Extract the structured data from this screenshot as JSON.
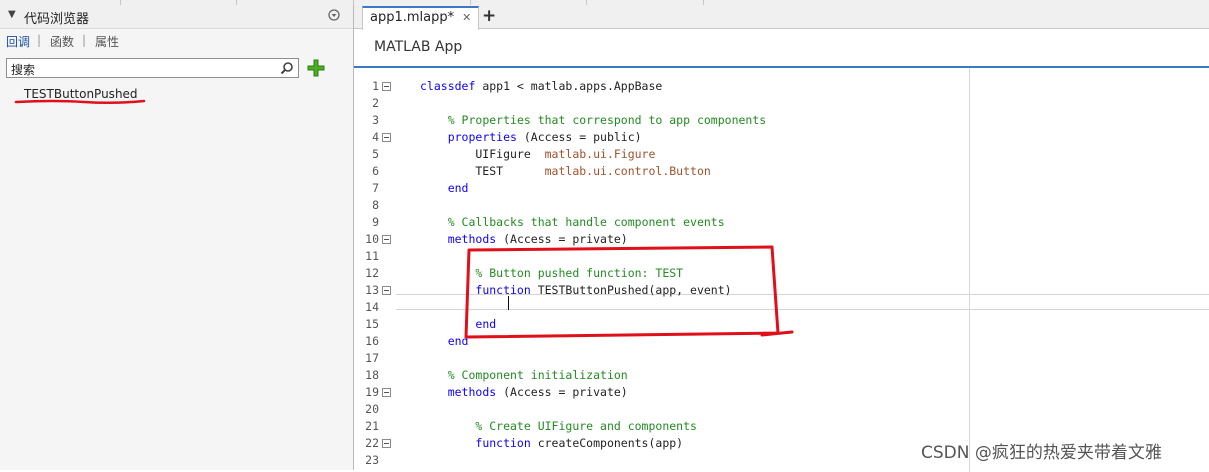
{
  "top_strip": {},
  "left_panel": {
    "title": "代码浏览器",
    "tabs": [
      "回调",
      "函数",
      "属性"
    ],
    "search_placeholder": "搜索",
    "callbacks": [
      "TESTButtonPushed"
    ]
  },
  "editor": {
    "tab_label": "app1.mlapp*",
    "app_title": "MATLAB App",
    "cursor_line": 14,
    "lines": [
      {
        "n": "1",
        "fold": true,
        "t": [
          [
            "kw",
            "classdef"
          ],
          [
            "pl",
            " app1 < matlab.apps.AppBase"
          ]
        ]
      },
      {
        "n": "2",
        "fold": false,
        "t": []
      },
      {
        "n": "3",
        "fold": false,
        "t": [
          [
            "pl",
            "    "
          ],
          [
            "cm",
            "% Properties that correspond to app components"
          ]
        ]
      },
      {
        "n": "4",
        "fold": true,
        "t": [
          [
            "pl",
            "    "
          ],
          [
            "kw",
            "properties"
          ],
          [
            "pl",
            " (Access = public)"
          ]
        ]
      },
      {
        "n": "5",
        "fold": false,
        "t": [
          [
            "pl",
            "        UIFigure  "
          ],
          [
            "ty",
            "matlab.ui.Figure"
          ]
        ]
      },
      {
        "n": "6",
        "fold": false,
        "t": [
          [
            "pl",
            "        TEST      "
          ],
          [
            "ty",
            "matlab.ui.control.Button"
          ]
        ]
      },
      {
        "n": "7",
        "fold": false,
        "t": [
          [
            "pl",
            "    "
          ],
          [
            "kw",
            "end"
          ]
        ]
      },
      {
        "n": "8",
        "fold": false,
        "t": []
      },
      {
        "n": "9",
        "fold": false,
        "t": [
          [
            "pl",
            "    "
          ],
          [
            "cm",
            "% Callbacks that handle component events"
          ]
        ]
      },
      {
        "n": "10",
        "fold": true,
        "t": [
          [
            "pl",
            "    "
          ],
          [
            "kw",
            "methods"
          ],
          [
            "pl",
            " (Access = private)"
          ]
        ]
      },
      {
        "n": "11",
        "fold": false,
        "t": []
      },
      {
        "n": "12",
        "fold": false,
        "t": [
          [
            "pl",
            "        "
          ],
          [
            "cm",
            "% Button pushed function: TEST"
          ]
        ]
      },
      {
        "n": "13",
        "fold": true,
        "t": [
          [
            "pl",
            "        "
          ],
          [
            "kw",
            "function"
          ],
          [
            "pl",
            " TESTButtonPushed(app, event)"
          ]
        ]
      },
      {
        "n": "14",
        "fold": false,
        "t": []
      },
      {
        "n": "15",
        "fold": false,
        "t": [
          [
            "pl",
            "        "
          ],
          [
            "kw",
            "end"
          ]
        ]
      },
      {
        "n": "16",
        "fold": false,
        "t": [
          [
            "pl",
            "    "
          ],
          [
            "kw",
            "end"
          ]
        ]
      },
      {
        "n": "17",
        "fold": false,
        "t": []
      },
      {
        "n": "18",
        "fold": false,
        "t": [
          [
            "pl",
            "    "
          ],
          [
            "cm",
            "% Component initialization"
          ]
        ]
      },
      {
        "n": "19",
        "fold": true,
        "t": [
          [
            "pl",
            "    "
          ],
          [
            "kw",
            "methods"
          ],
          [
            "pl",
            " (Access = private)"
          ]
        ]
      },
      {
        "n": "20",
        "fold": false,
        "t": []
      },
      {
        "n": "21",
        "fold": false,
        "t": [
          [
            "pl",
            "        "
          ],
          [
            "cm",
            "% Create UIFigure and components"
          ]
        ]
      },
      {
        "n": "22",
        "fold": true,
        "t": [
          [
            "pl",
            "        "
          ],
          [
            "kw",
            "function"
          ],
          [
            "pl",
            " createComponents(app)"
          ]
        ]
      },
      {
        "n": "23",
        "fold": false,
        "t": []
      }
    ]
  },
  "watermark": "CSDN @疯狂的热爱夹带着文雅",
  "colors": {
    "keyword": "#0e00ff",
    "comment": "#228b22",
    "type": "#a0522d",
    "annotation": "#e0101a",
    "accent": "#3b78c6"
  }
}
